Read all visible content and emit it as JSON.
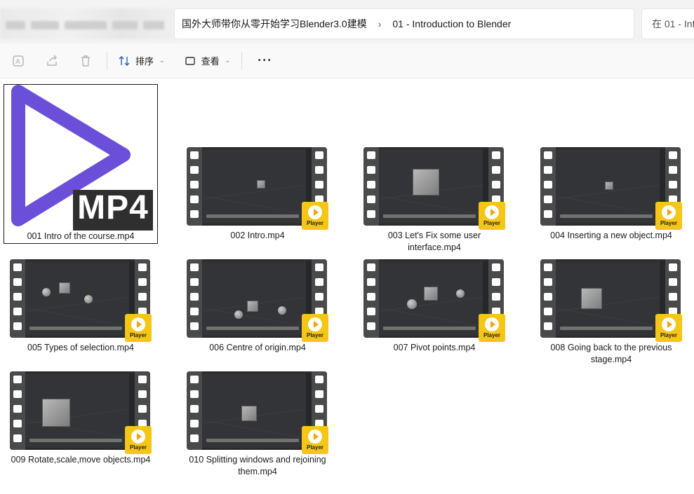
{
  "breadcrumb": {
    "folder": "国外大师带你从零开始学习Blender3.0建模",
    "subfolder": "01 - Introduction to Blender",
    "separator": "›"
  },
  "search": {
    "placeholder": "在 01 - Int"
  },
  "toolbar": {
    "sort_label": "排序",
    "view_label": "查看",
    "more_label": "···"
  },
  "large_icon": {
    "text": "MP4",
    "accent": "#6b4fd8"
  },
  "badge_text": "Player",
  "files": [
    {
      "name": "001 Intro of the course.mp4",
      "thumb": "mp4-icon",
      "selected": true
    },
    {
      "name": "002 Intro.mp4",
      "thumb": "video"
    },
    {
      "name": "003 Let's Fix some user interface.mp4",
      "thumb": "video"
    },
    {
      "name": "004 Inserting a new object.mp4",
      "thumb": "video"
    },
    {
      "name": "005 Types of selection.mp4",
      "thumb": "video"
    },
    {
      "name": "006 Centre of origin.mp4",
      "thumb": "video"
    },
    {
      "name": "007 Pivot points.mp4",
      "thumb": "video"
    },
    {
      "name": "008 Going back to the previous stage.mp4",
      "thumb": "video"
    },
    {
      "name": "009 Rotate,scale,move objects.mp4",
      "thumb": "video"
    },
    {
      "name": "010 Splitting windows and rejoining them.mp4",
      "thumb": "video"
    }
  ]
}
